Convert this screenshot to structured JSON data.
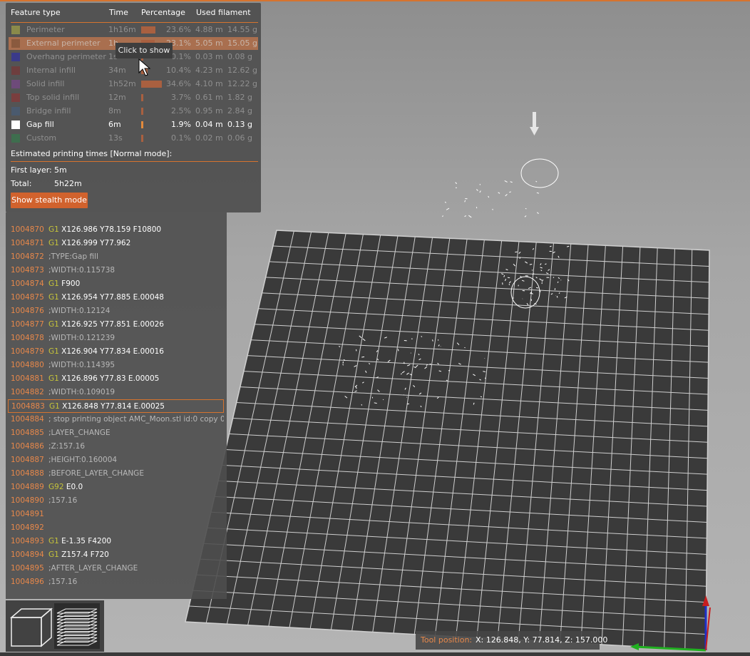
{
  "legend": {
    "headers": {
      "feature": "Feature type",
      "time": "Time",
      "percentage": "Percentage",
      "filament": "Used filament"
    },
    "rows": [
      {
        "name": "Perimeter",
        "time": "1h16m",
        "bar": 0.236,
        "pct": "23.6%",
        "length": "4.88 m",
        "weight": "14.55 g",
        "color": "#8a8a4a",
        "state": "dim"
      },
      {
        "name": "External perimeter",
        "time": "1h",
        "bar": 0.231,
        "pct": "23.1%",
        "length": "5.05 m",
        "weight": "15.05 g",
        "color": "#8a5a3e",
        "state": "highlight"
      },
      {
        "name": "Overhang perimeter",
        "time": "1s",
        "bar": 0.001,
        "pct": "0.1%",
        "length": "0.03 m",
        "weight": "0.08 g",
        "color": "#3a3a8a",
        "state": "dim"
      },
      {
        "name": "Internal infill",
        "time": "34m",
        "bar": 0.104,
        "pct": "10.4%",
        "length": "4.23 m",
        "weight": "12.62 g",
        "color": "#6e3e3e",
        "state": "dim"
      },
      {
        "name": "Solid infill",
        "time": "1h52m",
        "bar": 0.346,
        "pct": "34.6%",
        "length": "4.10 m",
        "weight": "12.22 g",
        "color": "#6e4a7a",
        "state": "dim"
      },
      {
        "name": "Top solid infill",
        "time": "12m",
        "bar": 0.037,
        "pct": "3.7%",
        "length": "0.61 m",
        "weight": "1.82 g",
        "color": "#7a3e3e",
        "state": "dim"
      },
      {
        "name": "Bridge infill",
        "time": "8m",
        "bar": 0.025,
        "pct": "2.5%",
        "length": "0.95 m",
        "weight": "2.84 g",
        "color": "#4a5a6e",
        "state": "dim"
      },
      {
        "name": "Gap fill",
        "time": "6m",
        "bar": 0.019,
        "pct": "1.9%",
        "length": "0.04 m",
        "weight": "0.13 g",
        "color": "#ffffff",
        "state": "active"
      },
      {
        "name": "Custom",
        "time": "13s",
        "bar": 0.001,
        "pct": "0.1%",
        "length": "0.02 m",
        "weight": "0.06 g",
        "color": "#3e6e4e",
        "state": "dim"
      }
    ],
    "estimated_title": "Estimated printing times [Normal mode]:",
    "first_layer_label": "First layer:",
    "first_layer_value": "5m",
    "total_label": "Total:",
    "total_value": "5h22m",
    "stealth_button": "Show stealth mode",
    "tooltip": "Click to show"
  },
  "gcode": {
    "lines": [
      {
        "num": "1004870",
        "cmd": "G1",
        "args": "X126.986 Y78.159 F10800",
        "comment": ""
      },
      {
        "num": "1004871",
        "cmd": "G1",
        "args": "X126.999 Y77.962",
        "comment": ""
      },
      {
        "num": "1004872",
        "cmd": "",
        "args": "",
        "comment": ";TYPE:Gap fill"
      },
      {
        "num": "1004873",
        "cmd": "",
        "args": "",
        "comment": ";WIDTH:0.115738"
      },
      {
        "num": "1004874",
        "cmd": "G1",
        "args": "F900",
        "comment": ""
      },
      {
        "num": "1004875",
        "cmd": "G1",
        "args": "X126.954 Y77.885 E.00048",
        "comment": ""
      },
      {
        "num": "1004876",
        "cmd": "",
        "args": "",
        "comment": ";WIDTH:0.12124"
      },
      {
        "num": "1004877",
        "cmd": "G1",
        "args": "X126.925 Y77.851 E.00026",
        "comment": ""
      },
      {
        "num": "1004878",
        "cmd": "",
        "args": "",
        "comment": ";WIDTH:0.121239"
      },
      {
        "num": "1004879",
        "cmd": "G1",
        "args": "X126.904 Y77.834 E.00016",
        "comment": ""
      },
      {
        "num": "1004880",
        "cmd": "",
        "args": "",
        "comment": ";WIDTH:0.114395"
      },
      {
        "num": "1004881",
        "cmd": "G1",
        "args": "X126.896 Y77.83 E.00005",
        "comment": ""
      },
      {
        "num": "1004882",
        "cmd": "",
        "args": "",
        "comment": ";WIDTH:0.109019"
      },
      {
        "num": "1004883",
        "cmd": "G1",
        "args": "X126.848 Y77.814 E.00025",
        "comment": "",
        "current": true
      },
      {
        "num": "1004884",
        "cmd": "",
        "args": "",
        "comment": "; stop printing object AMC_Moon.stl id:0 copy 0"
      },
      {
        "num": "1004885",
        "cmd": "",
        "args": "",
        "comment": ";LAYER_CHANGE"
      },
      {
        "num": "1004886",
        "cmd": "",
        "args": "",
        "comment": ";Z:157.16"
      },
      {
        "num": "1004887",
        "cmd": "",
        "args": "",
        "comment": ";HEIGHT:0.160004"
      },
      {
        "num": "1004888",
        "cmd": "",
        "args": "",
        "comment": ";BEFORE_LAYER_CHANGE"
      },
      {
        "num": "1004889",
        "cmd": "G92",
        "args": "E0.0",
        "comment": ""
      },
      {
        "num": "1004890",
        "cmd": "",
        "args": "",
        "comment": ";157.16"
      },
      {
        "num": "1004891",
        "cmd": "",
        "args": "",
        "comment": ""
      },
      {
        "num": "1004892",
        "cmd": "",
        "args": "",
        "comment": ""
      },
      {
        "num": "1004893",
        "cmd": "G1",
        "args": "E-1.35 F4200",
        "comment": ""
      },
      {
        "num": "1004894",
        "cmd": "G1",
        "args": "Z157.4 F720",
        "comment": ""
      },
      {
        "num": "1004895",
        "cmd": "",
        "args": "",
        "comment": ";AFTER_LAYER_CHANGE"
      },
      {
        "num": "1004896",
        "cmd": "",
        "args": "",
        "comment": ";157.16"
      }
    ]
  },
  "view_buttons": [
    {
      "icon": "cube-view-icon",
      "selected": false
    },
    {
      "icon": "layers-view-icon",
      "selected": true
    }
  ],
  "tool_position": {
    "label": "Tool position:",
    "value": "X: 126.848, Y: 77.814, Z: 157.000"
  },
  "colors": {
    "accent": "#d6732e",
    "bed": "#3a3a3a",
    "grid": "#d0d0d0"
  }
}
